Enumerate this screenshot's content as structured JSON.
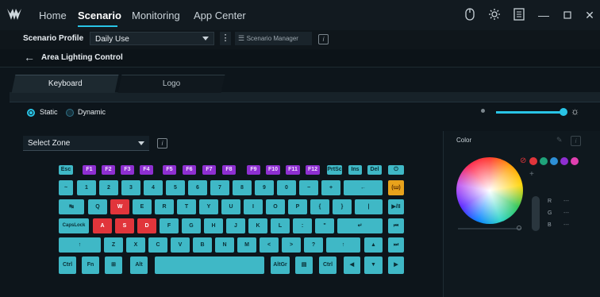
{
  "nav": {
    "tabs": [
      "Home",
      "Scenario",
      "Monitoring",
      "App Center"
    ],
    "active": "Scenario"
  },
  "window_icons": [
    "mouse-icon",
    "gear-icon",
    "list-icon",
    "minimize-icon",
    "maximize-icon",
    "close-icon"
  ],
  "profile": {
    "label": "Scenario Profile",
    "value": "Daily Use",
    "manager_label": "Scenario Manager"
  },
  "page_title": "Area Lighting Control",
  "lighting_tabs": [
    "Keyboard",
    "Logo"
  ],
  "mode": {
    "static_label": "Static",
    "dynamic_label": "Dynamic",
    "selected": "Static"
  },
  "brightness": {
    "level": 1.0
  },
  "zone": {
    "value": "Select Zone"
  },
  "color": {
    "title": "Color",
    "swatches": [
      "#e1353b",
      "#1fa37a",
      "#2d8fd6",
      "#8e2fd1",
      "#e040b0"
    ]
  },
  "rgb": {
    "r_label": "R",
    "g_label": "G",
    "b_label": "B",
    "r": "---",
    "g": "---",
    "b": "---"
  },
  "keyboard": {
    "row0": [
      "Esc",
      "F1",
      "F2",
      "F3",
      "F4",
      "F5",
      "F6",
      "F7",
      "F8",
      "F9",
      "F10",
      "F11",
      "F12",
      "PrtSc",
      "Ins",
      "Del",
      "⏻"
    ],
    "row1": [
      "~",
      "1",
      "2",
      "3",
      "4",
      "5",
      "6",
      "7",
      "8",
      "9",
      "0",
      "−",
      "+",
      "←",
      "(ա)"
    ],
    "row2": [
      "↹",
      "Q",
      "W",
      "E",
      "R",
      "T",
      "Y",
      "U",
      "I",
      "O",
      "P",
      "{",
      "}",
      "|",
      "▶/II"
    ],
    "row3": [
      "CapsLock",
      "A",
      "S",
      "D",
      "F",
      "G",
      "H",
      "J",
      "K",
      "L",
      ":",
      "\"",
      "↵",
      "⏮"
    ],
    "row4": [
      "↑",
      "Z",
      "X",
      "C",
      "V",
      "B",
      "N",
      "M",
      "<",
      ">",
      "?",
      "↑",
      "▲",
      "⏭"
    ],
    "row5": [
      "Ctrl",
      "Fn",
      "⊞",
      "Alt",
      "",
      "AltGr",
      "▤",
      "Ctrl",
      "◀",
      "▼",
      "▶"
    ]
  }
}
